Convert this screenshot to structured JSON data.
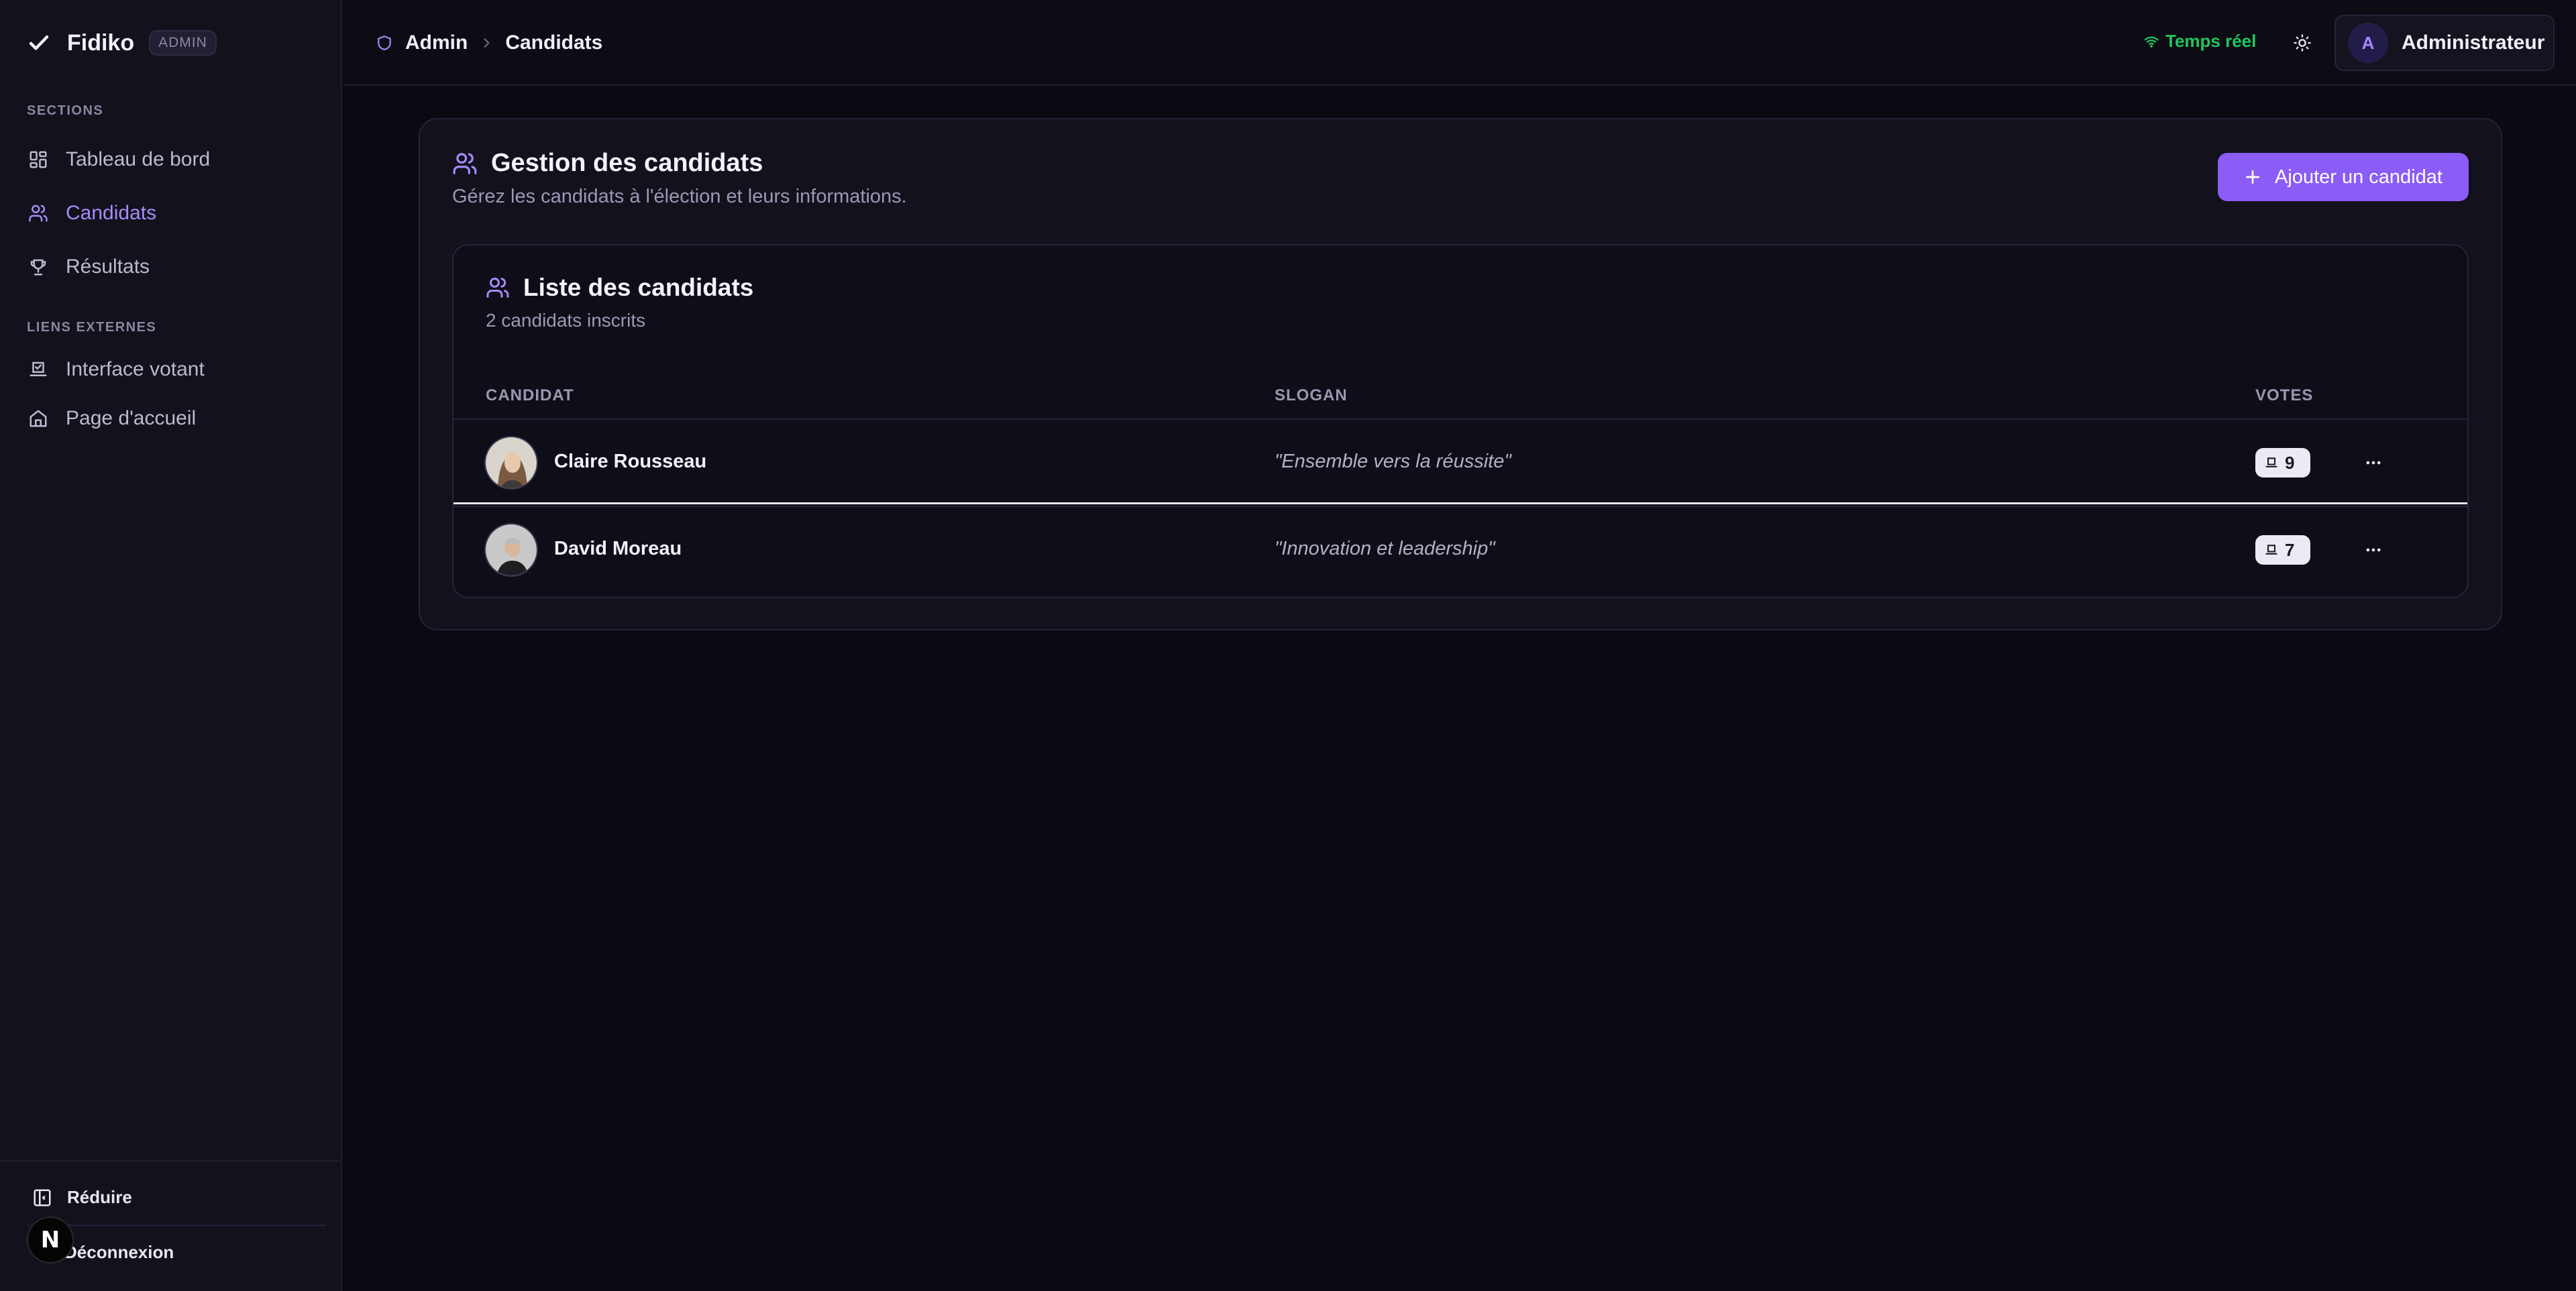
{
  "brand": {
    "name": "Fidiko",
    "badge": "ADMIN"
  },
  "sidebar": {
    "sections_title": "SECTIONS",
    "items": [
      {
        "label": "Tableau de bord",
        "icon": "dashboard-icon",
        "active": false
      },
      {
        "label": "Candidats",
        "icon": "users-icon",
        "active": true
      },
      {
        "label": "Résultats",
        "icon": "trophy-icon",
        "active": false
      }
    ],
    "external_title": "LIENS EXTERNES",
    "external": [
      {
        "label": "Interface votant",
        "icon": "vote-icon"
      },
      {
        "label": "Page d'accueil",
        "icon": "home-icon"
      }
    ],
    "collapse_label": "Réduire",
    "logout_label": "Déconnexion",
    "next_badge": "N"
  },
  "topbar": {
    "breadcrumb": [
      "Admin",
      "Candidats"
    ],
    "realtime_label": "Temps réel",
    "user_initial": "A",
    "user_name": "Administrateur"
  },
  "page": {
    "title": "Gestion des candidats",
    "subtitle": "Gérez les candidats à l'élection et leurs informations.",
    "add_button": "Ajouter un candidat"
  },
  "list": {
    "title": "Liste des candidats",
    "count_text": "2 candidats inscrits",
    "columns": {
      "candidate": "CANDIDAT",
      "slogan": "SLOGAN",
      "votes": "VOTES"
    },
    "rows": [
      {
        "name": "Claire Rousseau",
        "slogan": "\"Ensemble vers la réussite\"",
        "votes": "9"
      },
      {
        "name": "David Moreau",
        "slogan": "\"Innovation et leadership\"",
        "votes": "7"
      }
    ]
  },
  "colors": {
    "accent": "#8b5cf6",
    "accent_text": "#a78bfa",
    "live": "#22c55e",
    "background": "#0b0a12"
  }
}
